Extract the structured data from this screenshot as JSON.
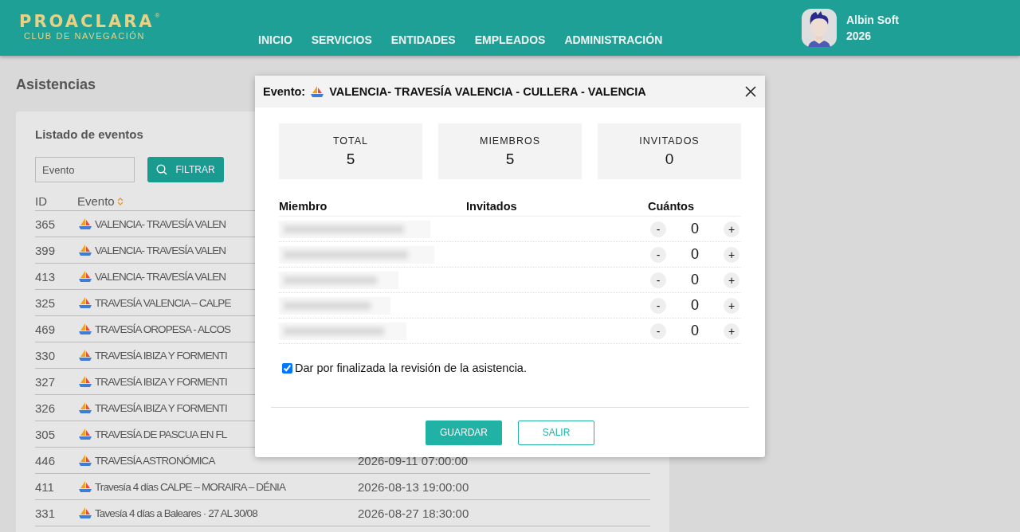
{
  "header": {
    "logo_title": "PROACLARA",
    "logo_mark": "®",
    "logo_subtitle": "CLUB DE NAVEGACIÓN",
    "nav": [
      {
        "label": "INICIO"
      },
      {
        "label": "SERVICIOS"
      },
      {
        "label": "ENTIDADES"
      },
      {
        "label": "EMPLEADOS"
      },
      {
        "label": "ADMINISTRACIÓN"
      }
    ],
    "user": {
      "name": "Albin Soft",
      "year": "2026"
    }
  },
  "page_title": "Asistencias",
  "list": {
    "title": "Listado de eventos",
    "filter_placeholder": "Evento",
    "filter_button": "FILTRAR",
    "columns": [
      {
        "label": "ID",
        "sortable": false
      },
      {
        "label": "Evento",
        "sortable": true
      }
    ],
    "rows": [
      {
        "id": "365",
        "event": "VALENCIA- TRAVESÍA VALEN"
      },
      {
        "id": "399",
        "event": "VALENCIA- TRAVESÍA VALEN"
      },
      {
        "id": "413",
        "event": "VALENCIA- TRAVESÍA VALEN"
      },
      {
        "id": "325",
        "event": "TRAVESÍA VALENCIA – CALPE"
      },
      {
        "id": "469",
        "event": "TRAVESÍA OROPESA - ALCOS"
      },
      {
        "id": "330",
        "event": "TRAVESÍA IBIZA Y FORMENTI"
      },
      {
        "id": "327",
        "event": "TRAVESÍA IBIZA Y FORMENTI"
      },
      {
        "id": "326",
        "event": "TRAVESÍA IBIZA Y FORMENTI"
      },
      {
        "id": "305",
        "event": "TRAVESÍA DE PASCUA EN FL"
      },
      {
        "id": "446",
        "event": "TRAVESÍA ASTRONÓMICA",
        "date": "2026-09-11 07:00:00"
      },
      {
        "id": "411",
        "event": "Travesía 4 días CALPE – MORAIRA – DÉNIA",
        "date": "2026-08-13 19:00:00"
      },
      {
        "id": "331",
        "event": "Tavesía 4 días a Baleares · 27 AL 30/08",
        "date": "2026-08-27 18:30:00"
      }
    ]
  },
  "dialog": {
    "label": "Evento:",
    "title": "VALENCIA- TRAVESÍA VALENCIA - CULLERA - VALENCIA",
    "stats": [
      {
        "label": "TOTAL",
        "value": "5"
      },
      {
        "label": "MIEMBROS",
        "value": "5"
      },
      {
        "label": "INVITADOS",
        "value": "0"
      }
    ],
    "columns": [
      "Miembro",
      "Invitados",
      "Cuántos"
    ],
    "members": [
      {
        "count": "0",
        "minus": "-",
        "plus": "+"
      },
      {
        "count": "0",
        "minus": "-",
        "plus": "+"
      },
      {
        "count": "0",
        "minus": "-",
        "plus": "+"
      },
      {
        "count": "0",
        "minus": "-",
        "plus": "+"
      },
      {
        "count": "0",
        "minus": "-",
        "plus": "+"
      }
    ],
    "finalized": {
      "label": "Dar por finalizada la revisión de la asistencia.",
      "checked": true
    },
    "buttons": [
      {
        "label": "GUARDAR",
        "kind": "primary"
      },
      {
        "label": "SALIR",
        "kind": "outline"
      }
    ]
  }
}
